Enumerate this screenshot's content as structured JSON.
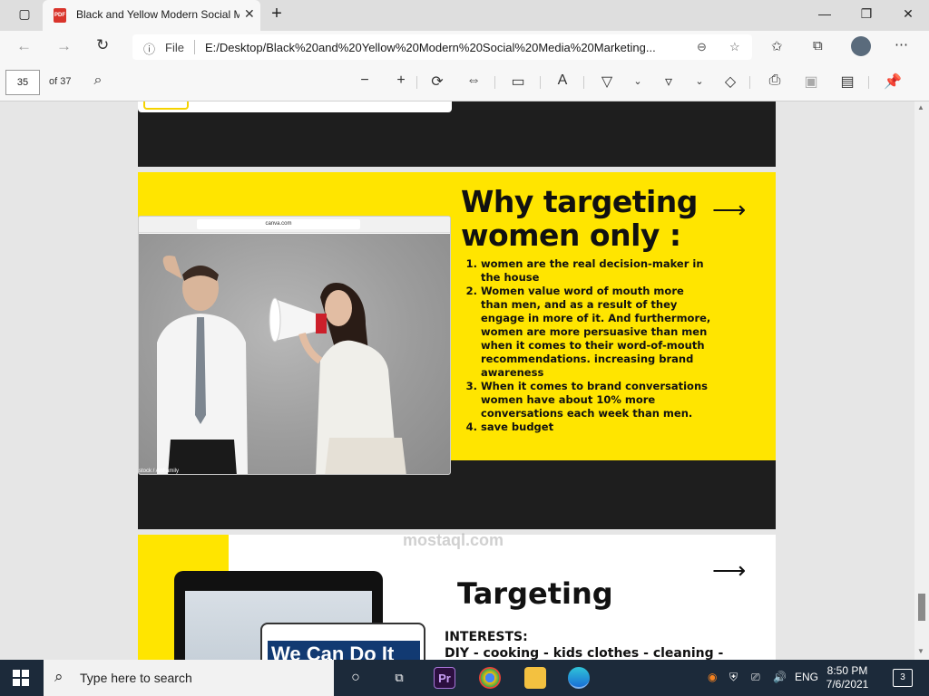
{
  "browser": {
    "tab_title": "Black and Yellow Modern Social Media Marketing",
    "tab_icon": "PDF",
    "address_prefix": "File",
    "url": "E:/Desktop/Black%20and%20Yellow%20Modern%20Social%20Media%20Marketing..."
  },
  "pdf_toolbar": {
    "page_number": "35",
    "page_total": "of 37"
  },
  "document": {
    "mock_url": "canva.com",
    "photo_credit": "stock / ArtFamily",
    "headline": "Why targeting women only :",
    "reasons": [
      " women are the real decision-maker in the house",
      "Women value word of mouth more than men, and as a result of they engage in more of it. And furthermore, women are more persuasive than men when it comes to their word-of-mouth recommendations. increasing brand awareness",
      "When it comes to brand conversations women have about 10% more conversations each week than men.",
      "save budget"
    ],
    "next_heading": "Targeting",
    "interests_label": "INTERESTS:",
    "interests_list": "DIY - cooking - kids clothes - cleaning -",
    "phone_banner": "We Can Do It"
  },
  "watermark": "mostaql.com",
  "taskbar": {
    "search_placeholder": "Type here to search",
    "language": "ENG",
    "time": "8:50 PM",
    "date": "7/6/2021",
    "notification_count": "3"
  },
  "colors": {
    "accent_yellow": "#ffe500",
    "dark": "#1e1e1e",
    "taskbar": "#1c2a3a"
  }
}
